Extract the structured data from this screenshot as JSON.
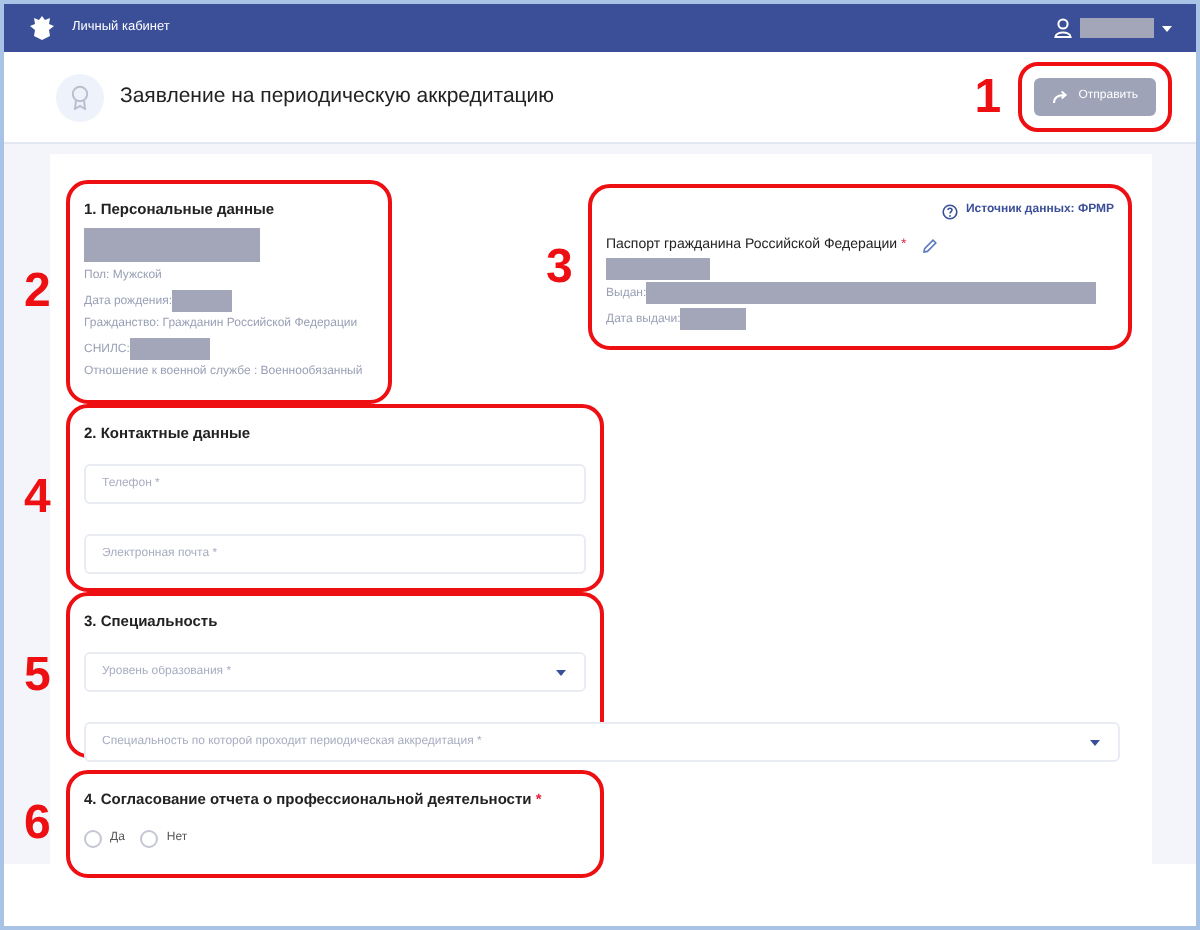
{
  "header": {
    "title": "Личный кабинет"
  },
  "page": {
    "title": "Заявление на периодическую аккредитацию",
    "submit": {
      "label": "Отправить",
      "disabled": true,
      "annotation": "1"
    }
  },
  "personal": {
    "title": "1. Персональные данные",
    "annotation": "2",
    "lines": [
      {
        "kind": "redaction"
      },
      {
        "kind": "text",
        "text": "Пол: Мужской"
      },
      {
        "kind": "field",
        "text": "Дата рождения:"
      },
      {
        "kind": "text",
        "text": "Гражданство: Гражданин Российской Федерации"
      },
      {
        "kind": "field",
        "text": "СНИЛС:"
      },
      {
        "kind": "text",
        "text": "Отношение к военной службе : Военнообязанный"
      }
    ]
  },
  "passport": {
    "annotation": "3",
    "source": "Источник данных: ФРМР",
    "label": "Паспорт гражданина Российской Федерации",
    "required_mark": "*",
    "lines": [
      {
        "kind": "redaction"
      },
      {
        "kind": "field",
        "text": "Выдан:"
      },
      {
        "kind": "field",
        "text": "Дата выдачи:"
      }
    ]
  },
  "contacts": {
    "title": "2. Контактные данные",
    "annotation": "4",
    "fields": [
      {
        "kind": "input",
        "placeholder": "Телефон *",
        "wide": false
      },
      {
        "kind": "input",
        "placeholder": "Электронная почта *",
        "wide": false
      }
    ]
  },
  "specialty": {
    "title": "3. Специальность",
    "annotation": "5",
    "fields": [
      {
        "kind": "select",
        "placeholder": "Уровень образования *",
        "wide": false
      },
      {
        "kind": "select",
        "placeholder": "Специальность по которой проходит периодическая аккредитация *",
        "wide": true
      }
    ]
  },
  "report": {
    "title": "4. Согласование отчета о профессиональной деятельности",
    "required_mark": "*",
    "annotation": "6",
    "options": [
      {
        "label": "Да",
        "selected": false
      },
      {
        "label": "Нет",
        "selected": false
      }
    ]
  }
}
